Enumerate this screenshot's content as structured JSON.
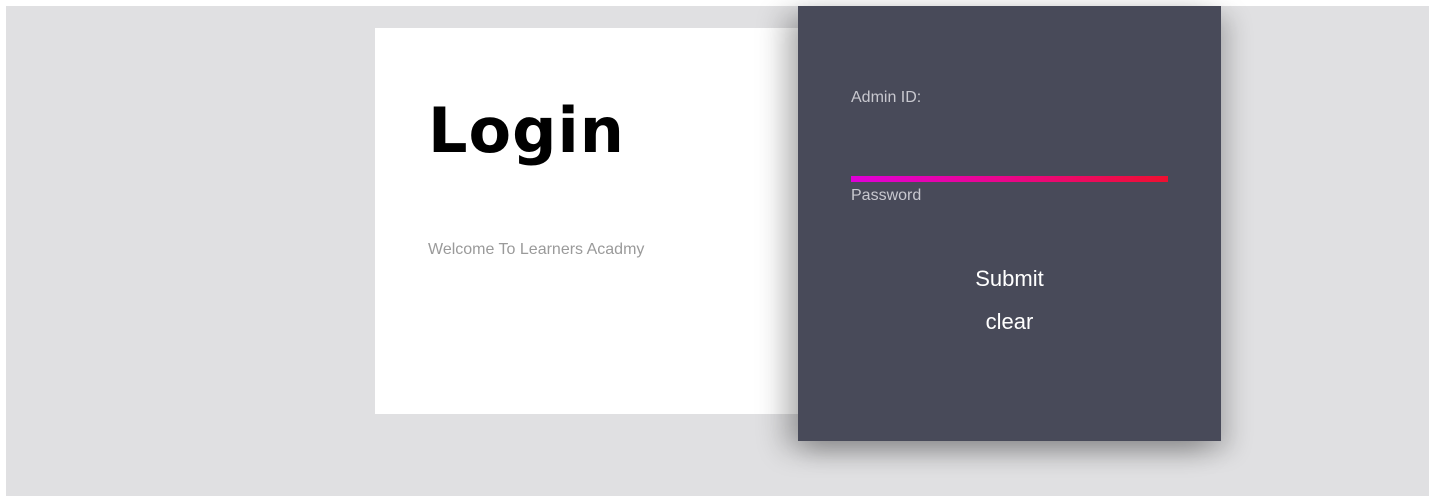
{
  "login_card": {
    "title": "Login",
    "welcome": "Welcome To Learners Acadmy"
  },
  "form": {
    "admin_label": "Admin ID:",
    "admin_value": "",
    "password_label": "Password",
    "submit_label": "Submit",
    "clear_label": "clear"
  },
  "colors": {
    "background": "#e0e0e2",
    "panel": "#484a59",
    "underline_start": "#e000d8",
    "underline_end": "#ee1030"
  }
}
